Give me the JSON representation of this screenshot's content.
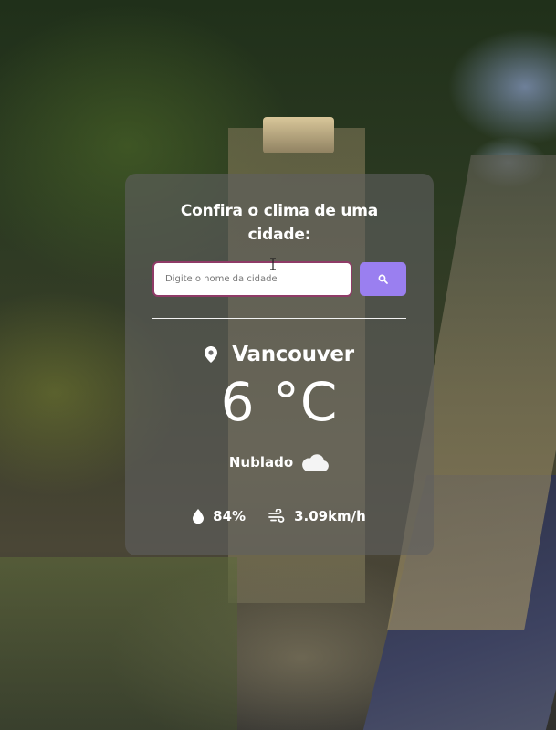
{
  "card": {
    "title": "Confira o clima de uma cidade:"
  },
  "search": {
    "placeholder": "Digite o nome da cidade",
    "value": "",
    "button_icon": "search-icon"
  },
  "weather": {
    "city": "Vancouver",
    "city_icon": "map-pin-icon",
    "temperature": "6 °C",
    "description": "Nublado",
    "description_icon": "cloud-icon",
    "humidity": "84%",
    "humidity_icon": "water-drop-icon",
    "wind": "3.09km/h",
    "wind_icon": "wind-icon"
  },
  "colors": {
    "card_background": "#5f5f5f",
    "search_button": "#9a7ff0",
    "input_border": "#8f3b67",
    "text": "#ffffff"
  }
}
